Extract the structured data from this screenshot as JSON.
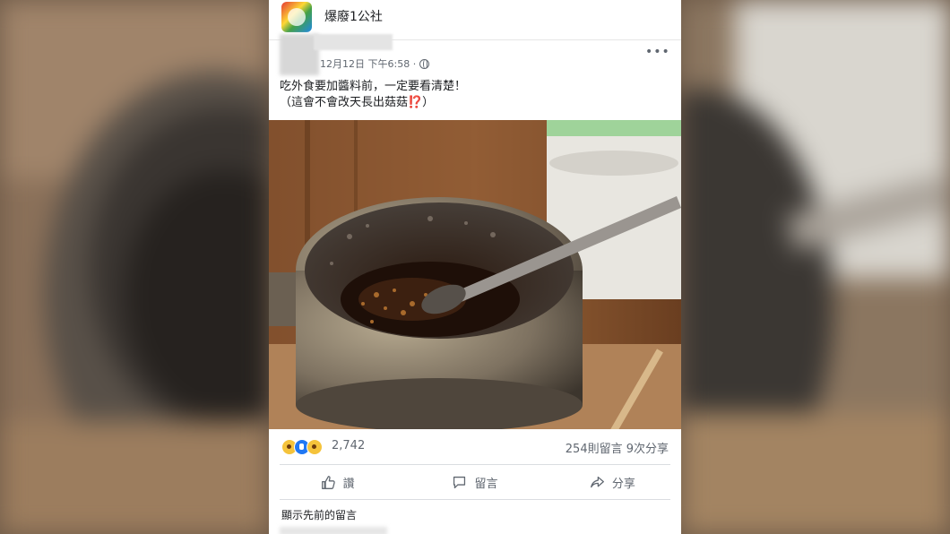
{
  "post": {
    "page_name": "爆廢1公社",
    "timestamp": "12月12日 下午6:58 ·",
    "more_label": "•••",
    "text_line1": "吃外食要加醬料前，一定要看清楚！",
    "text_line2": "（這會不會改天長出菇菇⁉️）"
  },
  "reactions": {
    "icons": [
      "wow-icon",
      "like-icon",
      "haha-icon"
    ],
    "count": "2,742",
    "stats": "254則留言   9次分享"
  },
  "actions": {
    "like_label": "讚",
    "comment_label": "留言",
    "share_label": "分享"
  },
  "comments": {
    "show_previous": "顯示先前的留言"
  },
  "colors": {
    "like_blue": "#2078f4",
    "emoji_yellow": "#f5c33b",
    "text_secondary": "#606770"
  }
}
